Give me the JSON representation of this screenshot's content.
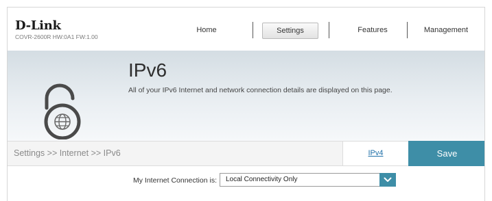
{
  "header": {
    "logo": "D-Link",
    "device_info": "COVR-2600R HW:0A1 FW:1.00",
    "nav": [
      {
        "label": "Home"
      },
      {
        "label": "Settings"
      },
      {
        "label": "Features"
      },
      {
        "label": "Management"
      }
    ],
    "active_nav": "Settings"
  },
  "hero": {
    "title": "IPv6",
    "description": "All of your IPv6 Internet and network connection details are displayed on this page.",
    "icon": "lock-globe-icon"
  },
  "toolbar": {
    "breadcrumb": "Settings >> Internet >> IPv6",
    "ipv4_link": "IPv4",
    "save_label": "Save"
  },
  "form": {
    "connection_label": "My Internet Connection is:",
    "connection_value": "Local Connectivity Only"
  },
  "colors": {
    "accent": "#3e8ea7",
    "link": "#1e6fa8"
  }
}
